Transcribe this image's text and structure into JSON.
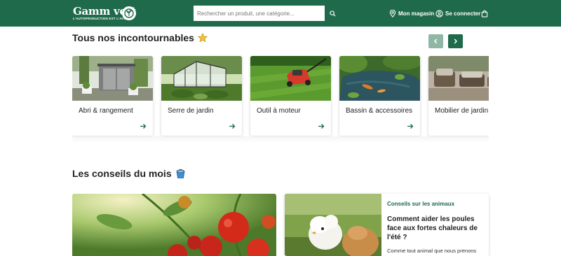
{
  "header": {
    "logo_text": "Gamm vert",
    "logo_tagline": "L'AUTOPRODUCTION EST L'AVENIR",
    "search_placeholder": "Rechercher un produit, une catégorie...",
    "nav": {
      "store": "Mon magasin",
      "login": "Se connecter"
    },
    "icons": {
      "search": "search-icon",
      "store": "location-pin-icon",
      "login": "user-icon",
      "cart": "shopping-bag-icon"
    }
  },
  "incontournables": {
    "title": "Tous nos incontournables",
    "title_icon": "star-icon",
    "prev_icon": "chevron-left-icon",
    "next_icon": "chevron-right-icon",
    "items": [
      {
        "label": "Abri & rangement"
      },
      {
        "label": "Serre de jardin"
      },
      {
        "label": "Outil à moteur"
      },
      {
        "label": "Bassin & accessoires"
      },
      {
        "label": "Mobilier de jardin"
      }
    ]
  },
  "conseils": {
    "title": "Les conseils du mois",
    "title_icon": "watering-bucket-icon",
    "featured": {
      "category": "Conseils sur les animaux",
      "title": "Comment aider les poules face aux fortes chaleurs de l'été ?",
      "excerpt": "Comme tout animal que nous prenons"
    }
  },
  "colors": {
    "brand": "#1e6a4a",
    "brand_light": "#8fb7a6",
    "star": "#f2c230"
  }
}
